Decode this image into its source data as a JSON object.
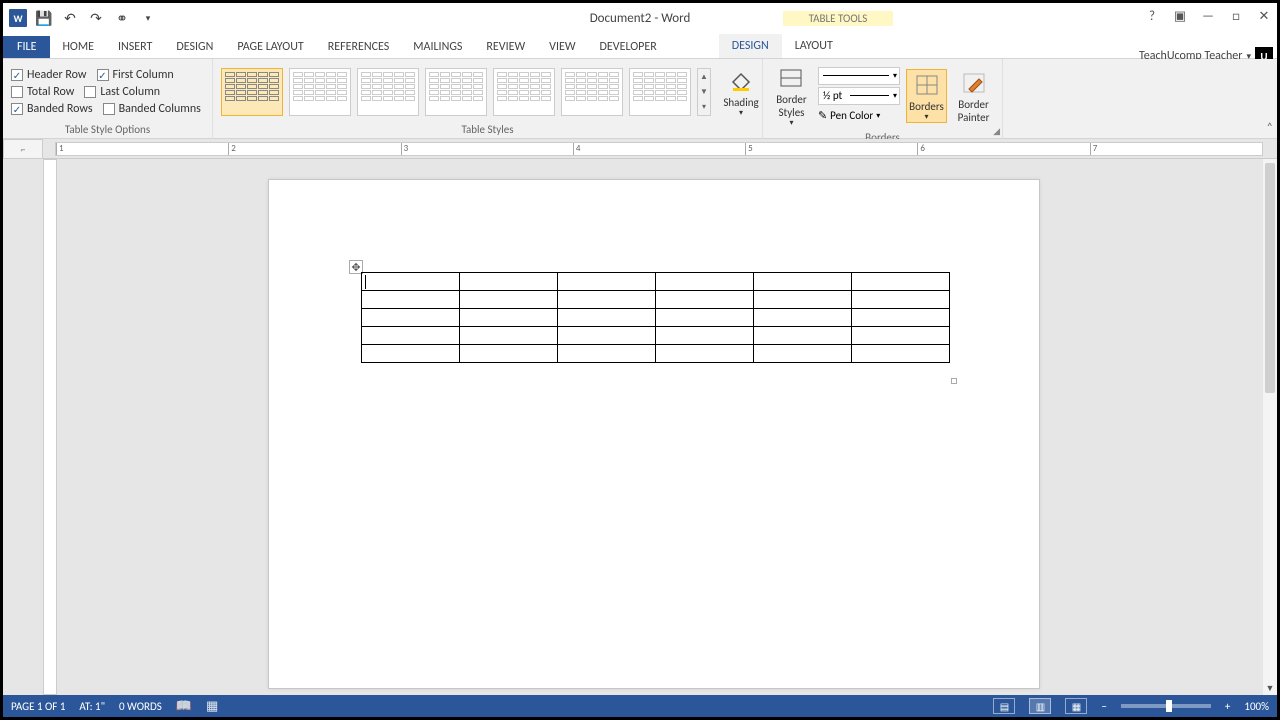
{
  "title": "Document2 - Word",
  "table_tools_label": "TABLE TOOLS",
  "user_name": "TeachUcomp Teacher",
  "tabs": {
    "file": "FILE",
    "home": "HOME",
    "insert": "INSERT",
    "design0": "DESIGN",
    "page_layout": "PAGE LAYOUT",
    "references": "REFERENCES",
    "mailings": "MAILINGS",
    "review": "REVIEW",
    "view": "VIEW",
    "developer": "DEVELOPER",
    "design": "DESIGN",
    "layout": "LAYOUT"
  },
  "style_options": {
    "header_row": {
      "label": "Header Row",
      "checked": true
    },
    "total_row": {
      "label": "Total Row",
      "checked": false
    },
    "banded_rows": {
      "label": "Banded Rows",
      "checked": true
    },
    "first_column": {
      "label": "First Column",
      "checked": true
    },
    "last_column": {
      "label": "Last Column",
      "checked": false
    },
    "banded_columns": {
      "label": "Banded Columns",
      "checked": false
    }
  },
  "groups": {
    "style_options": "Table Style Options",
    "table_styles": "Table Styles",
    "borders": "Borders"
  },
  "buttons": {
    "shading": "Shading",
    "border_styles": "Border Styles",
    "borders": "Borders",
    "border_painter": "Border Painter"
  },
  "border_opts": {
    "weight": "½ pt",
    "pen_color": "Pen Color"
  },
  "ruler_marks": [
    "1",
    "2",
    "3",
    "4",
    "5",
    "6",
    "7"
  ],
  "status": {
    "page": "PAGE 1 OF 1",
    "at": "AT: 1\"",
    "words": "0 WORDS",
    "zoom": "100%"
  },
  "doc_table": {
    "rows": 5,
    "cols": 6
  }
}
